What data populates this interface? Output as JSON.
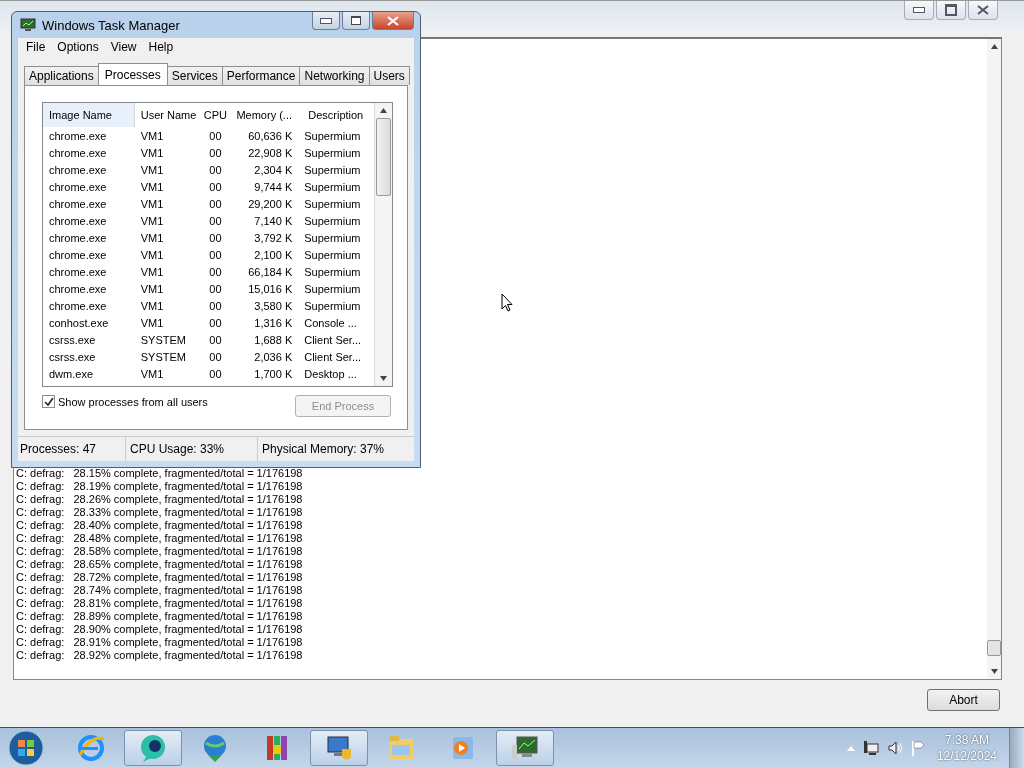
{
  "background_window": {
    "log_lines": [
      "C: defrag:   28.15% complete, fragmented/total = 1/176198",
      "C: defrag:   28.19% complete, fragmented/total = 1/176198",
      "C: defrag:   28.26% complete, fragmented/total = 1/176198",
      "C: defrag:   28.33% complete, fragmented/total = 1/176198",
      "C: defrag:   28.40% complete, fragmented/total = 1/176198",
      "C: defrag:   28.48% complete, fragmented/total = 1/176198",
      "C: defrag:   28.58% complete, fragmented/total = 1/176198",
      "C: defrag:   28.65% complete, fragmented/total = 1/176198",
      "C: defrag:   28.72% complete, fragmented/total = 1/176198",
      "C: defrag:   28.74% complete, fragmented/total = 1/176198",
      "C: defrag:   28.81% complete, fragmented/total = 1/176198",
      "C: defrag:   28.89% complete, fragmented/total = 1/176198",
      "C: defrag:   28.90% complete, fragmented/total = 1/176198",
      "C: defrag:   28.91% complete, fragmented/total = 1/176198",
      "C: defrag:   28.92% complete, fragmented/total = 1/176198"
    ],
    "button": "Abort"
  },
  "task_manager": {
    "title": "Windows Task Manager",
    "menu": [
      "File",
      "Options",
      "View",
      "Help"
    ],
    "tabs": [
      {
        "label": "Applications",
        "selected": false
      },
      {
        "label": "Processes",
        "selected": true
      },
      {
        "label": "Services",
        "selected": false
      },
      {
        "label": "Performance",
        "selected": false
      },
      {
        "label": "Networking",
        "selected": false
      },
      {
        "label": "Users",
        "selected": false
      }
    ],
    "columns": [
      "Image Name",
      "User Name",
      "CPU",
      "Memory (...",
      "Description"
    ],
    "rows": [
      [
        "chrome.exe",
        "VM1",
        "00",
        "60,636 K",
        "Supermium"
      ],
      [
        "chrome.exe",
        "VM1",
        "00",
        "22,908 K",
        "Supermium"
      ],
      [
        "chrome.exe",
        "VM1",
        "00",
        "2,304 K",
        "Supermium"
      ],
      [
        "chrome.exe",
        "VM1",
        "00",
        "9,744 K",
        "Supermium"
      ],
      [
        "chrome.exe",
        "VM1",
        "00",
        "29,200 K",
        "Supermium"
      ],
      [
        "chrome.exe",
        "VM1",
        "00",
        "7,140 K",
        "Supermium"
      ],
      [
        "chrome.exe",
        "VM1",
        "00",
        "3,792 K",
        "Supermium"
      ],
      [
        "chrome.exe",
        "VM1",
        "00",
        "2,100 K",
        "Supermium"
      ],
      [
        "chrome.exe",
        "VM1",
        "00",
        "66,184 K",
        "Supermium"
      ],
      [
        "chrome.exe",
        "VM1",
        "00",
        "15,016 K",
        "Supermium"
      ],
      [
        "chrome.exe",
        "VM1",
        "00",
        "3,580 K",
        "Supermium"
      ],
      [
        "conhost.exe",
        "VM1",
        "00",
        "1,316 K",
        "Console ..."
      ],
      [
        "csrss.exe",
        "SYSTEM",
        "00",
        "1,688 K",
        "Client Ser..."
      ],
      [
        "csrss.exe",
        "SYSTEM",
        "00",
        "2,036 K",
        "Client Ser..."
      ],
      [
        "dwm.exe",
        "VM1",
        "00",
        "1,700 K",
        "Desktop ..."
      ]
    ],
    "show_all_users": {
      "label": "Show processes from all users",
      "checked": true
    },
    "end_process": {
      "label": "End Process",
      "disabled": true
    },
    "status_bar": [
      "Processes: 47",
      "CPU Usage: 33%",
      "Physical Memory: 37%"
    ]
  },
  "taskbar": {
    "time": "7:38 AM",
    "date": "12/12/2024"
  }
}
